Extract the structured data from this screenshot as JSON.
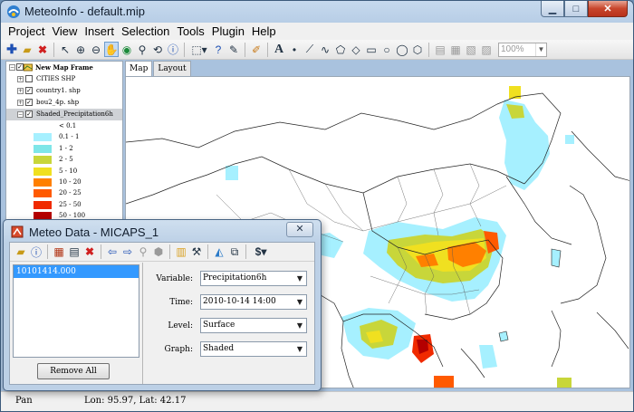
{
  "window": {
    "title": "MeteoInfo - default.mip"
  },
  "menu": [
    "Project",
    "View",
    "Insert",
    "Selection",
    "Tools",
    "Plugin",
    "Help"
  ],
  "toolbar": {
    "zoom_value": "100%"
  },
  "layers_panel": {
    "frame_label": "New Map Frame",
    "layers": [
      {
        "label": "CITIES SHP",
        "checked": false
      },
      {
        "label": "country1. shp",
        "checked": true
      },
      {
        "label": "bou2_4p. shp",
        "checked": true
      },
      {
        "label": "Shaded_Precipitation6h",
        "checked": true
      }
    ],
    "legend": [
      {
        "label": "< 0.1",
        "color": "#ffffff"
      },
      {
        "label": "0.1 - 1",
        "color": "#a6f0ff"
      },
      {
        "label": "1 - 2",
        "color": "#7ee6e8"
      },
      {
        "label": "2 - 5",
        "color": "#c8d63a"
      },
      {
        "label": "5 - 10",
        "color": "#f0e020"
      },
      {
        "label": "10 - 20",
        "color": "#ff8000"
      },
      {
        "label": "20 - 25",
        "color": "#ff5a00"
      },
      {
        "label": "25 - 50",
        "color": "#f02a00"
      },
      {
        "label": "50 - 100",
        "color": "#b40000"
      },
      {
        "label": "> 100",
        "color": "#780000"
      }
    ]
  },
  "tabs": [
    "Map",
    "Layout"
  ],
  "status": {
    "tool": "Pan",
    "coordinates": "Lon: 95.97, Lat: 42.17"
  },
  "dialog": {
    "title": "Meteo Data - MICAPS_1",
    "close_label": "✕",
    "files": [
      "10101414.000"
    ],
    "remove_all_label": "Remove All",
    "variable_label": "Variable:",
    "variable_value": "Precipitation6h",
    "time_label": "Time:",
    "time_value": "2010-10-14 14:00",
    "level_label": "Level:",
    "level_value": "Surface",
    "graph_label": "Graph:",
    "graph_value": "Shaded"
  }
}
